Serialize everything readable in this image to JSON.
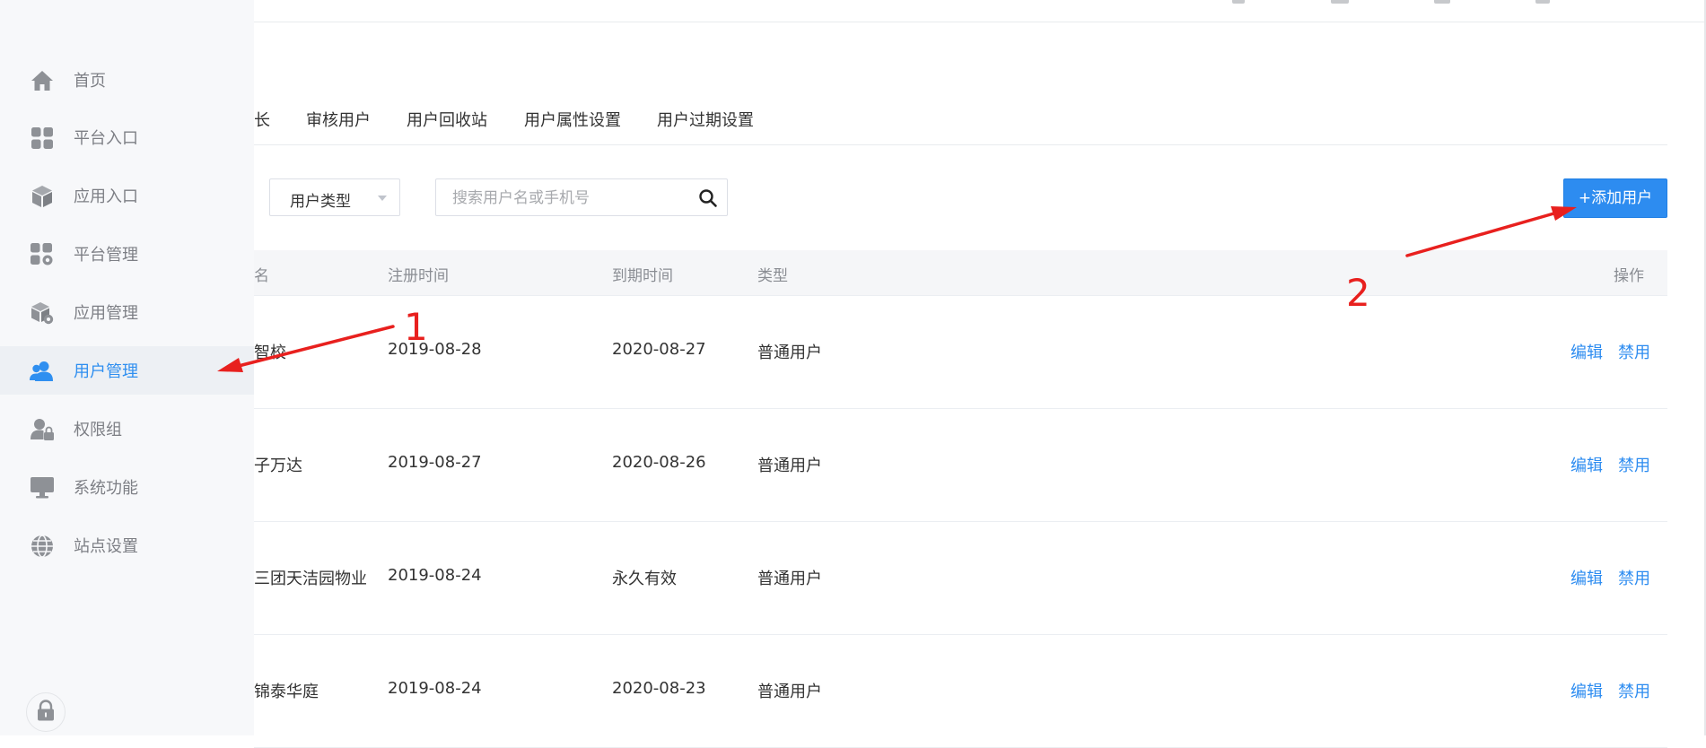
{
  "sidebar": {
    "items": [
      {
        "label": "首页",
        "icon": "home-icon",
        "active": false
      },
      {
        "label": "平台入口",
        "icon": "grid-icon",
        "active": false
      },
      {
        "label": "应用入口",
        "icon": "cube-icon",
        "active": false
      },
      {
        "label": "平台管理",
        "icon": "grid-gear-icon",
        "active": false
      },
      {
        "label": "应用管理",
        "icon": "cube-gear-icon",
        "active": false
      },
      {
        "label": "用户管理",
        "icon": "users-icon",
        "active": true
      },
      {
        "label": "权限组",
        "icon": "user-lock-icon",
        "active": false
      },
      {
        "label": "系统功能",
        "icon": "monitor-icon",
        "active": false
      },
      {
        "label": "站点设置",
        "icon": "globe-icon",
        "active": false
      }
    ]
  },
  "tabs": [
    "长",
    "审核用户",
    "用户回收站",
    "用户属性设置",
    "用户过期设置"
  ],
  "filter": {
    "user_type_value": "用户类型",
    "search_placeholder": "搜索用户名或手机号",
    "add_button": "+添加用户"
  },
  "table": {
    "headers": [
      "名",
      "注册时间",
      "到期时间",
      "类型",
      "操作"
    ],
    "rows": [
      {
        "name": "智校",
        "register": "2019-08-28",
        "expire": "2020-08-27",
        "type": "普通用户",
        "edit": "编辑",
        "disable": "禁用"
      },
      {
        "name": "子万达",
        "register": "2019-08-27",
        "expire": "2020-08-26",
        "type": "普通用户",
        "edit": "编辑",
        "disable": "禁用"
      },
      {
        "name": "三团天洁园物业",
        "register": "2019-08-24",
        "expire": "永久有效",
        "type": "普通用户",
        "edit": "编辑",
        "disable": "禁用"
      },
      {
        "name": "锦泰华庭",
        "register": "2019-08-24",
        "expire": "2020-08-23",
        "type": "普通用户",
        "edit": "编辑",
        "disable": "禁用"
      }
    ]
  },
  "annotations": {
    "first": "1",
    "second": "2"
  },
  "colors": {
    "accent": "#2d8cf0",
    "annotation": "#e8201e",
    "sidebar_bg": "#f7f8fa"
  }
}
